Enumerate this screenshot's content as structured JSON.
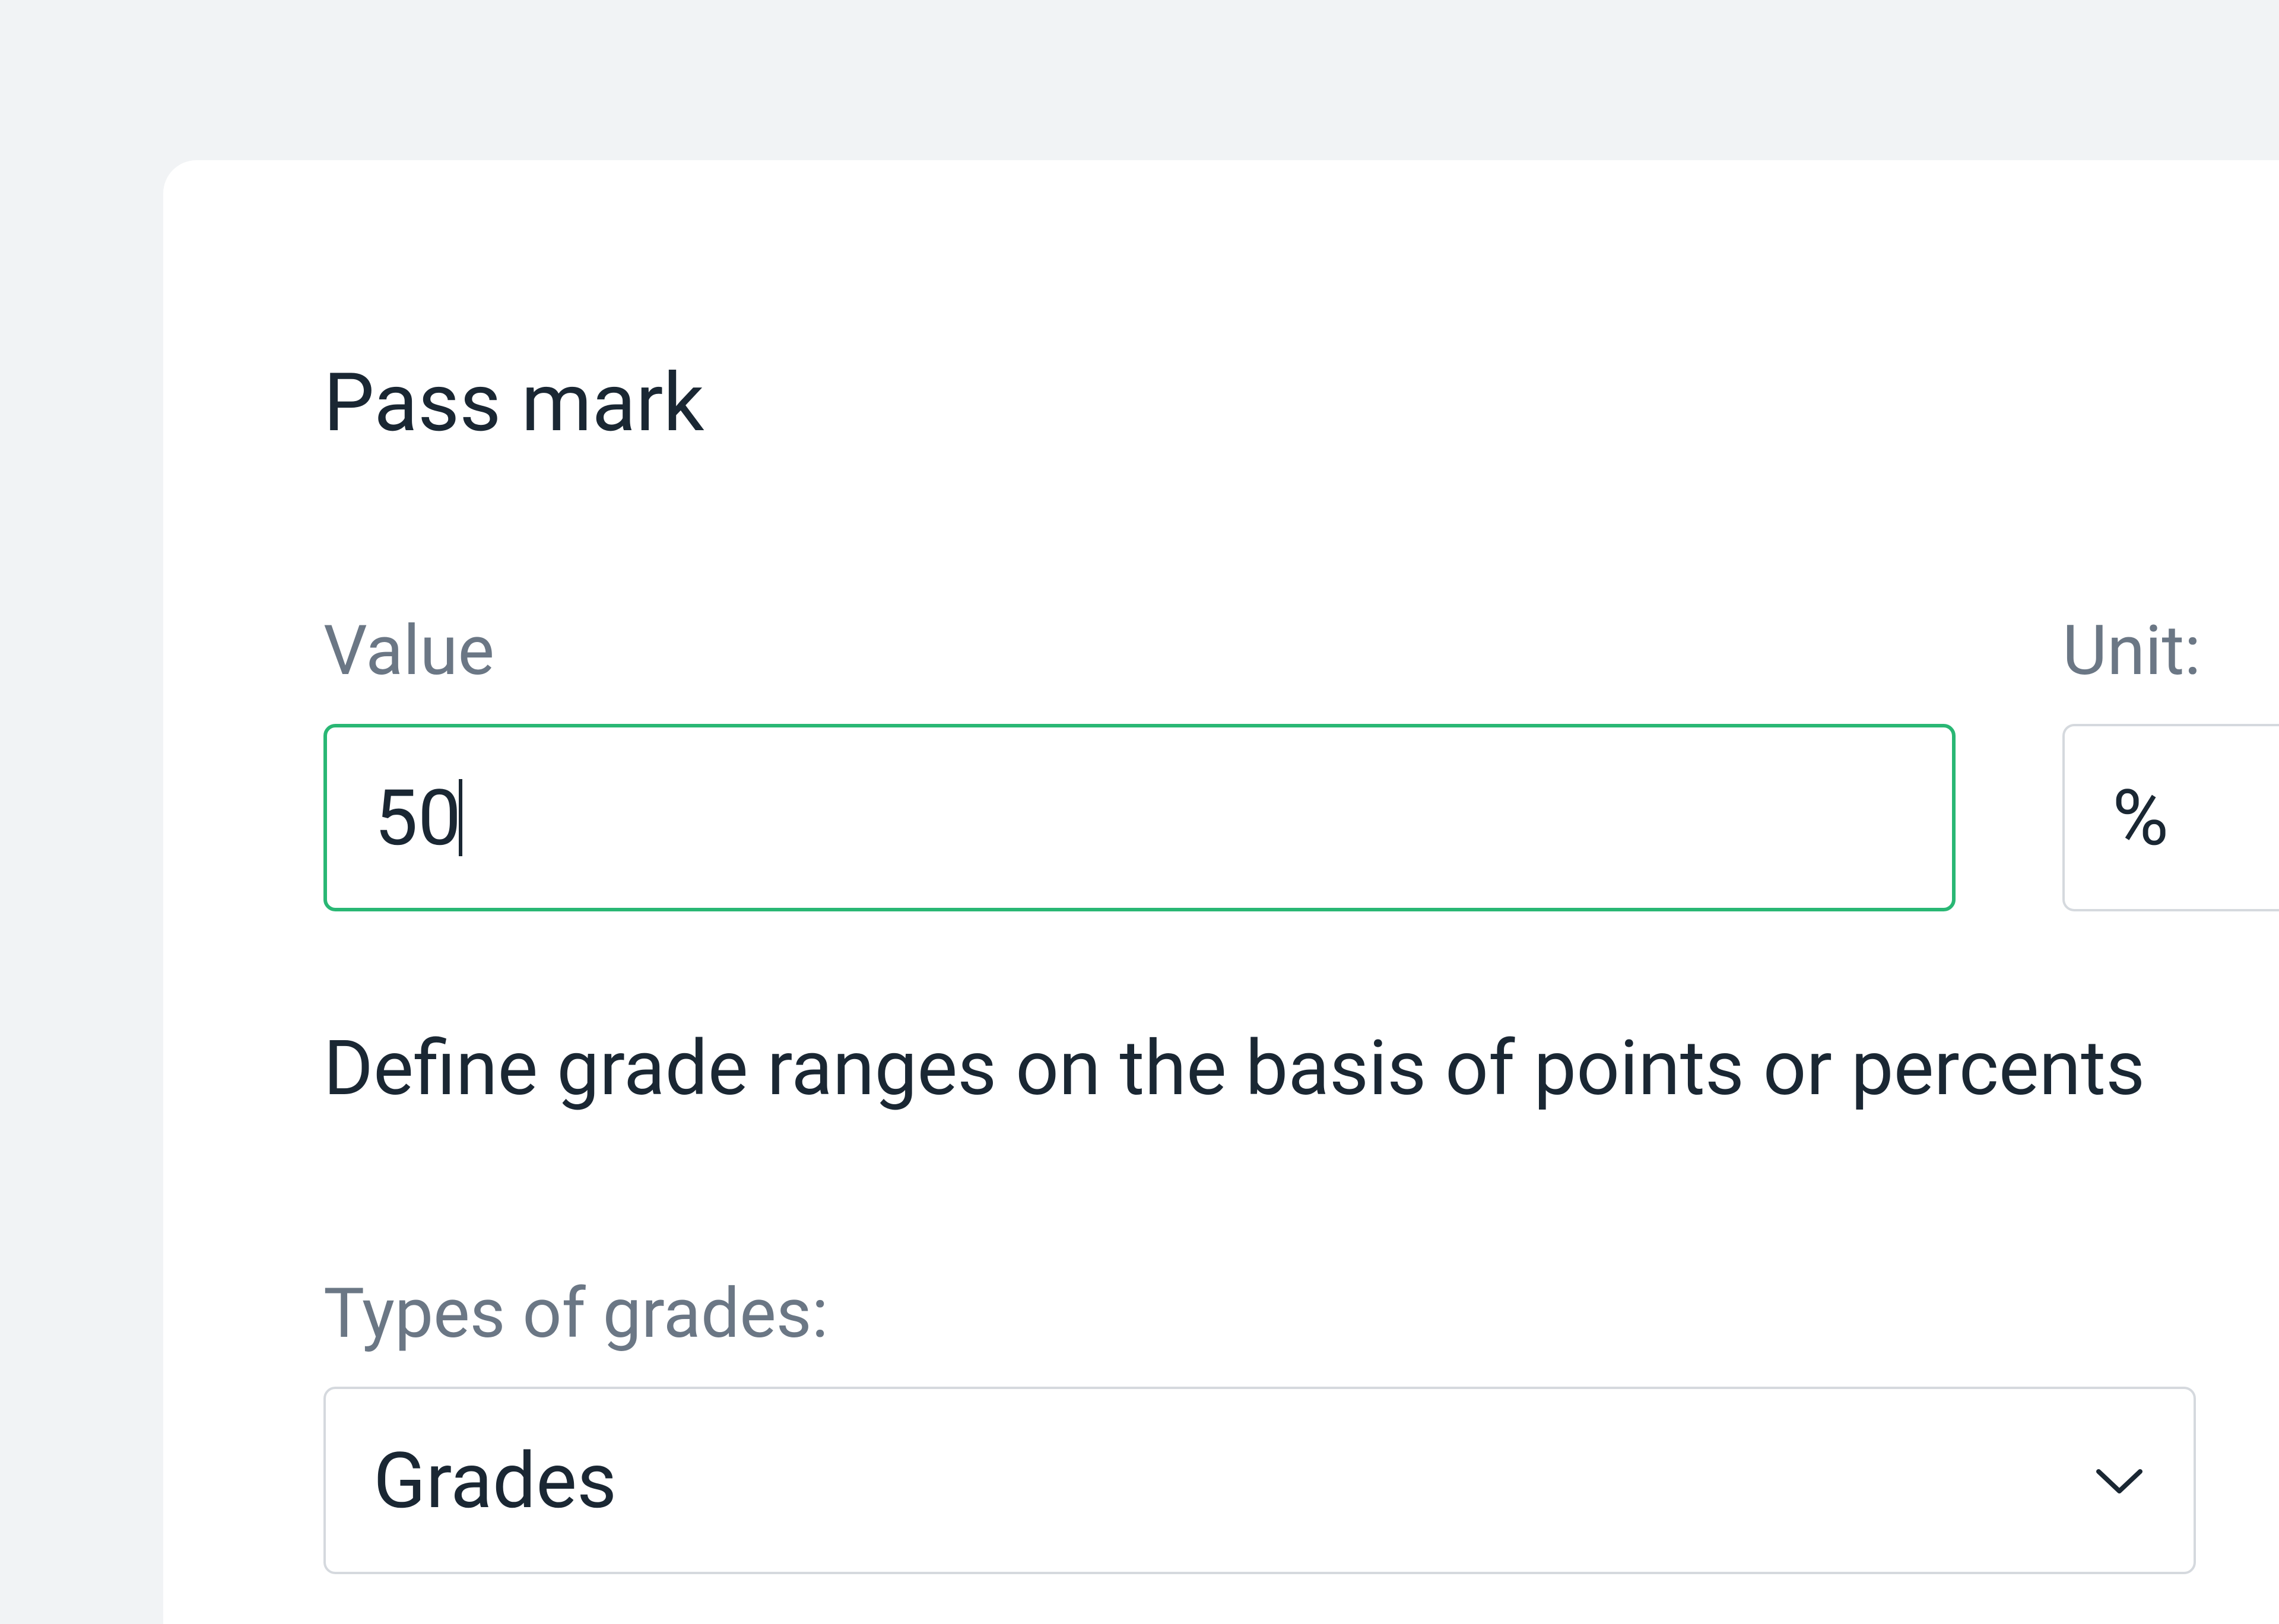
{
  "passMark": {
    "title": "Pass mark",
    "valueLabel": "Value",
    "value": "50",
    "unitLabel": "Unit:",
    "unit": "%"
  },
  "description": "Define grade ranges on the basis of points or percents",
  "gradeTypes": {
    "label": "Types of grades:",
    "selected": "Grades"
  }
}
